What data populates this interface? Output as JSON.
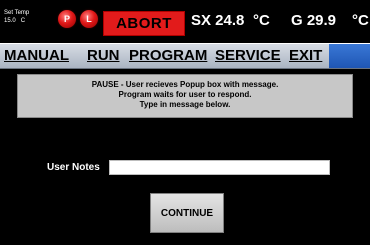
{
  "status": {
    "set_temp_label": "Set Temp",
    "set_temp_value": "15.0",
    "set_temp_unit": "C",
    "led_p": "P",
    "led_l": "L",
    "abort_label": "ABORT",
    "sx_label": "SX 24.8",
    "sx_unit": "°C",
    "g_label": "G 29.9",
    "g_unit": "°C"
  },
  "menu": {
    "items": [
      {
        "label": "MANUAL"
      },
      {
        "label": "RUN"
      },
      {
        "label": "PROGRAM"
      },
      {
        "label": "SERVICE"
      },
      {
        "label": "EXIT"
      }
    ]
  },
  "message": {
    "line1": "PAUSE - User recieves Popup box with message.",
    "line2": "Program waits for user to respond.",
    "line3": "Type in message below."
  },
  "notes": {
    "label": "User Notes",
    "value": ""
  },
  "continue_label": "CONTINUE",
  "colors": {
    "abort": "#e21b1b",
    "led": "#e01818",
    "menu_bg": "#aab4c2",
    "menu_accent": "#1f56b4",
    "message_bg": "#c7c7c7",
    "screen_bg": "#000000"
  }
}
